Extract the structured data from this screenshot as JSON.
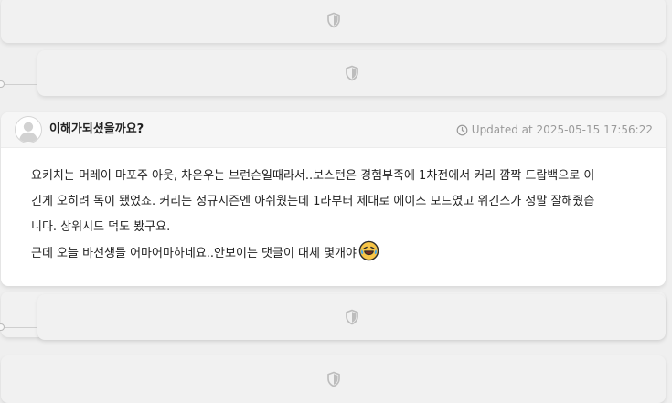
{
  "hidden_comments": [
    {
      "icon": "shield-icon"
    },
    {
      "icon": "shield-icon"
    },
    {
      "icon": "shield-icon"
    },
    {
      "icon": "shield-icon"
    }
  ],
  "comment": {
    "author": "이해가되셨을까요?",
    "updated_label": "Updated at 2025-05-15 17:56:22",
    "body_lines": [
      "요키치는 머레이 마포주 아웃, 차은우는 브런슨일때라서..보스턴은 경험부족에 1차전에서 커리 깜짝 드랍백으로 이",
      "긴게 오히려 독이 됐었죠. 커리는 정규시즌엔 아쉬웠는데 1라부터 제대로 에이스 모드였고 위긴스가 정말 잘해줬습",
      "니다. 상위시드 덕도 봤구요.",
      "근데 오늘 바선생들 어마어마하네요..안보이는 댓글이 대체 몇개야"
    ],
    "emoji": "laughing-tears-emoji"
  },
  "colors": {
    "page_bg": "#efefef",
    "card_bg": "#ffffff",
    "header_bg": "#f6f6f6",
    "muted_text": "#9a9a9a",
    "body_text": "#222222",
    "emoji_yellow": "#f7c548"
  }
}
